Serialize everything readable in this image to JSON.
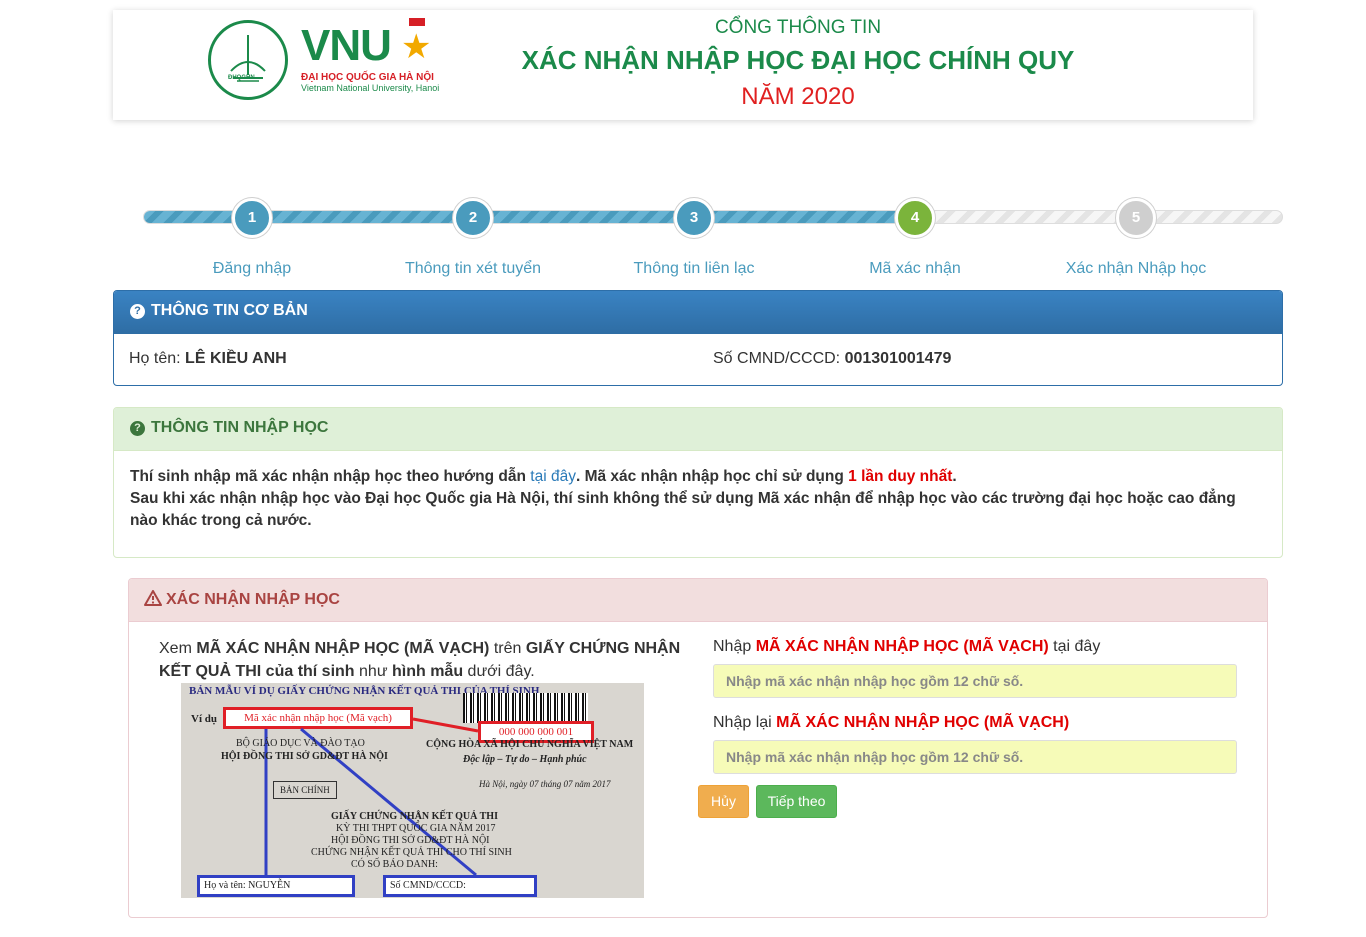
{
  "header": {
    "logo_abbr": "VNU",
    "logo_seal_text": "ĐHQGHN",
    "logo_name_vi": "ĐẠI HỌC QUỐC GIA HÀ NỘI",
    "logo_name_en": "Vietnam National University, Hanoi",
    "title_line1": "CỔNG THÔNG TIN",
    "title_line2": "XÁC NHẬN NHẬP HỌC ĐẠI HỌC CHÍNH QUY",
    "title_line3": "NĂM 2020"
  },
  "steps": [
    {
      "number": "1",
      "label": "Đăng nhập",
      "state": "done"
    },
    {
      "number": "2",
      "label": "Thông tin xét tuyển",
      "state": "done"
    },
    {
      "number": "3",
      "label": "Thông tin liên lạc",
      "state": "done"
    },
    {
      "number": "4",
      "label": "Mã xác nhận",
      "state": "current"
    },
    {
      "number": "5",
      "label": "Xác nhận Nhập học",
      "state": "todo"
    }
  ],
  "basic": {
    "title": "THÔNG TIN CƠ BẢN",
    "name_label": "Họ tên:",
    "name_value": "LÊ KIỀU ANH",
    "id_label": "Số CMND/CCCD:",
    "id_value": "001301001479"
  },
  "info": {
    "title": "THÔNG TIN NHẬP HỌC",
    "l1_a": "Thí sinh nhập mã xác nhận nhập học theo hướng dẫn ",
    "l1_link": "tại đây",
    "l1_b": ". Mã xác nhận nhập học chỉ sử dụng ",
    "l1_red": "1 lần duy nhất",
    "l1_c": ".",
    "l2": "Sau khi xác nhận nhập học vào Đại học Quốc gia Hà Nội, thí sinh không thể sử dụng Mã xác nhận để nhập học vào các trường đại học hoặc cao đẳng nào khác trong cả nước."
  },
  "confirm": {
    "title": "XÁC NHẬN NHẬP HỌC",
    "lead_1": "Xem ",
    "lead_red": "MÃ XÁC NHẬN NHẬP HỌC (MÃ VẠCH)",
    "lead_2": " trên ",
    "lead_bold1": "GIẤY CHỨNG NHẬN KẾT QUẢ THI",
    "lead_3": " ",
    "lead_blue": "của thí sinh",
    "lead_4": " như ",
    "lead_bold2": "hình mẫu",
    "lead_5": " dưới đây.",
    "sample": {
      "heading": "BẢN MẪU VÍ DỤ GIẤY CHỨNG NHẬN KẾT QUẢ THI CỦA THÍ SINH",
      "example": "Ví dụ",
      "code_label": "Mã xác nhận nhập học (Mã vạch)",
      "code_value": "000 000 000 001",
      "left1": "BỘ GIÁO DỤC VÀ ĐÀO TẠO",
      "left2": "HỘI ĐỒNG THI SỞ GD&ĐT HÀ NỘI",
      "right1": "CỘNG HÒA XÃ HỘI CHỦ NGHĨA VIỆT NAM",
      "right2": "Độc lập – Tự do – Hạnh phúc",
      "date": "Hà Nội, ngày 07 tháng 07 năm 2017",
      "ban_chinh": "BẢN CHÍNH",
      "c1": "GIẤY CHỨNG NHẬN KẾT QUẢ THI",
      "c2": "KỲ THI THPT QUỐC GIA NĂM 2017",
      "c3": "HỘI ĐỒNG THI SỞ GD&ĐT HÀ NỘI",
      "c4": "CHỨNG NHẬN KẾT QUẢ THI CHO THÍ SINH",
      "c5": "CÓ SỐ BÁO DANH:",
      "name_box": "Họ và tên: NGUYỄN",
      "id_box": "Số CMND/CCCD:"
    },
    "input1_label_a": "Nhập ",
    "input1_label_red": "MÃ XÁC NHẬN NHẬP HỌC (MÃ VẠCH)",
    "input1_label_b": " tại đây",
    "input1_placeholder": "Nhập mã xác nhận nhập học gồm 12 chữ số.",
    "input2_label_a": "Nhập lại ",
    "input2_label_red": "MÃ XÁC NHẬN NHẬP HỌC (MÃ VẠCH)",
    "input2_placeholder": "Nhập mã xác nhận nhập học gồm 12 chữ số.",
    "cancel_label": "Hủy",
    "next_label": "Tiếp theo"
  },
  "colors": {
    "brand_green": "#1b8a4a",
    "step_done": "#4a9bbd",
    "step_current": "#7bb43b",
    "step_todo": "#cfcfcf",
    "cancel": "#f0ad4e",
    "next": "#5cb85c"
  },
  "icons": [
    "question-circle-icon",
    "warning-icon",
    "star-icon"
  ]
}
